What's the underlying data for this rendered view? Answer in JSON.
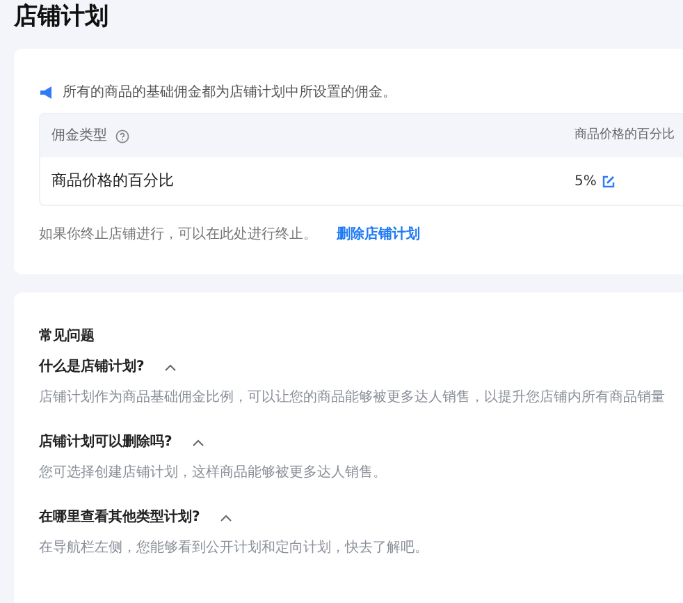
{
  "title": "店铺计划",
  "plan_card": {
    "notice": "所有的商品的基础佣金都为店铺计划中所设置的佣金。",
    "table": {
      "columns": [
        {
          "label": "佣金类型",
          "kind": "with_help"
        },
        {
          "label": "商品价格的百分比",
          "kind": "plain"
        }
      ],
      "rows": [
        {
          "cells": [
            "商品价格的百分比",
            "5%"
          ],
          "editable": true
        }
      ]
    },
    "footer_text": "如果你终止店铺进行，可以在此处进行终止。",
    "delete_link": "删除店铺计划"
  },
  "faq": {
    "heading": "常见问题",
    "items": [
      {
        "question": "什么是店铺计划?",
        "expanded": true,
        "answer": "店铺计划作为商品基础佣金比例，可以让您的商品能够被更多达人销售，以提升您店铺内所有商品销量"
      },
      {
        "question": "店铺计划可以删除吗?",
        "expanded": true,
        "answer": "您可选择创建店铺计划，这样商品能够被更多达人销售。"
      },
      {
        "question": "在哪里查看其他类型计划?",
        "expanded": true,
        "answer": "在导航栏左侧，您能够看到公开计划和定向计划，快去了解吧。"
      }
    ]
  }
}
